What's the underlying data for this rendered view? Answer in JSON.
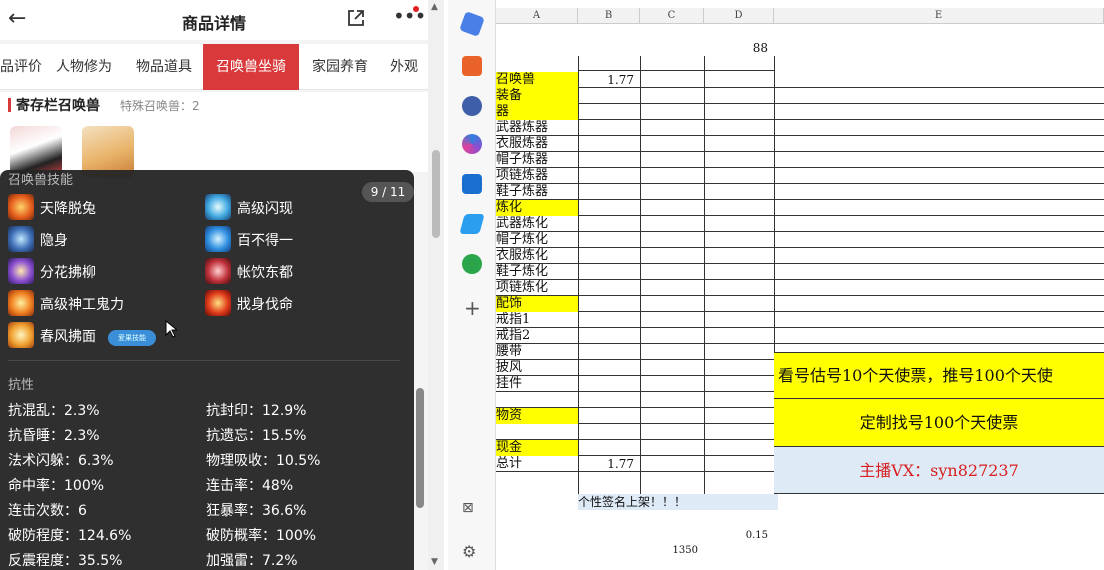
{
  "phone": {
    "title": "商品详情",
    "tabs": [
      "品评价",
      "人物修为",
      "物品道具",
      "召唤兽坐骑",
      "家园养育",
      "外观"
    ],
    "active_tab": 3,
    "storage": {
      "heading": "寄存栏召唤兽",
      "sub": "特殊召唤兽：2"
    },
    "popup": {
      "section_skills": "召唤兽技能",
      "pager": "9 / 11",
      "skills": [
        "天降脱兔",
        "高级闪现",
        "隐身",
        "百不得一",
        "分花拂柳",
        "帐饮东都",
        "高级神工鬼力",
        "戕身伐命",
        "春风拂面"
      ],
      "badge": "爱果技能",
      "section_resist": "抗性",
      "attrs": [
        [
          "抗混乱：2.3%",
          "抗封印：12.9%"
        ],
        [
          "抗昏睡：2.3%",
          "抗遗忘：15.5%"
        ],
        [
          "法术闪躲：6.3%",
          "物理吸收：10.5%"
        ],
        [
          "命中率：100%",
          "连击率：48%"
        ],
        [
          "连击次数：6",
          "狂暴率：36.6%"
        ],
        [
          "破防程度：124.6%",
          "破防概率：100%"
        ],
        [
          "反震程度：35.5%",
          "加强雷：7.2%"
        ]
      ]
    }
  },
  "sheet": {
    "columns": [
      "A",
      "B",
      "C",
      "D",
      "E"
    ],
    "d_top": "88",
    "rows": [
      "召唤兽",
      "装备",
      "器",
      "武器炼器",
      "衣服炼器",
      "帽子炼器",
      "项链炼器",
      "鞋子炼器",
      "炼化",
      "武器炼化",
      "帽子炼化",
      "衣服炼化",
      "鞋子炼化",
      "项链炼化",
      "配饰",
      "戒指1",
      "戒指2",
      "腰带",
      "披风",
      "挂件",
      "",
      "物资",
      "",
      "现金",
      "总计"
    ],
    "b_zhaohuan": "1.77",
    "b_total": "1.77",
    "footer_note": "个性签名上架！！！",
    "d_bottom": "0.15",
    "c_bottom": "1350",
    "e_line1": "看号估号10个天使票，推号100个天使",
    "e_line2": "定制找号100个天使票",
    "e_line3": "主播VX：syn827237",
    "colors": {
      "yellow": "#ffff00",
      "blue_cell": "#deeaf6",
      "red_text": "#d81e1e",
      "tab_red": "#d9393a"
    }
  }
}
